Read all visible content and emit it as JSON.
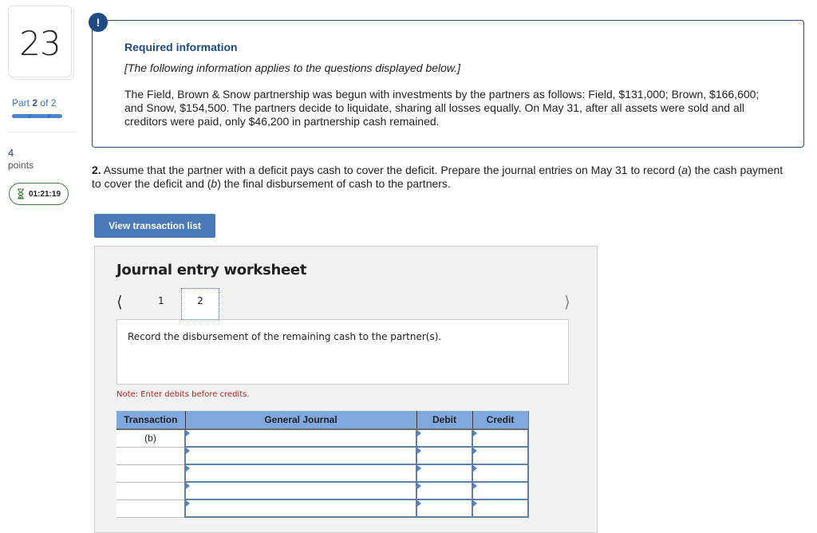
{
  "left_rail": {
    "question_number": "23",
    "part_word": "Part",
    "part_current": "2",
    "part_of": "of 2",
    "part_progress_fraction": 1.0,
    "points_value": "4",
    "points_label": "points",
    "timer": "01:21:19",
    "timer_icon": "hourglass-icon"
  },
  "info": {
    "badge": "!",
    "title": "Required information",
    "italic_note": "[The following information applies to the questions displayed below.]",
    "body": "The Field, Brown & Snow partnership was begun with investments by the partners as follows: Field, $131,000; Brown, $166,600; and Snow, $154,500. The partners decide to liquidate, sharing all losses equally. On May 31, after all assets were sold and all creditors were paid, only $46,200 in partnership cash remained."
  },
  "question": {
    "number": "2.",
    "text_1": " Assume that the partner with a deficit pays cash to cover the deficit. Prepare the journal entries on May 31 to record (",
    "a": "a",
    "text_2": ") the cash payment to cover the deficit and (",
    "b": "b",
    "text_3": ") the final disbursement of cash to the partners."
  },
  "view_transaction_button": "View transaction list",
  "worksheet": {
    "title": "Journal entry worksheet",
    "prev_icon": "chevron-left-icon",
    "next_icon": "chevron-right-icon",
    "tabs": [
      "1",
      "2"
    ],
    "active_tab": "2",
    "prompt": "Record the disbursement of the remaining cash to the partner(s).",
    "note": "Note: Enter debits before credits.",
    "columns": [
      "Transaction",
      "General Journal",
      "Debit",
      "Credit"
    ],
    "rows": [
      {
        "transaction": "(b)",
        "account": "",
        "debit": "",
        "credit": ""
      },
      {
        "transaction": "",
        "account": "",
        "debit": "",
        "credit": ""
      },
      {
        "transaction": "",
        "account": "",
        "debit": "",
        "credit": ""
      },
      {
        "transaction": "",
        "account": "",
        "debit": "",
        "credit": ""
      },
      {
        "transaction": "",
        "account": "",
        "debit": "",
        "credit": ""
      }
    ]
  }
}
